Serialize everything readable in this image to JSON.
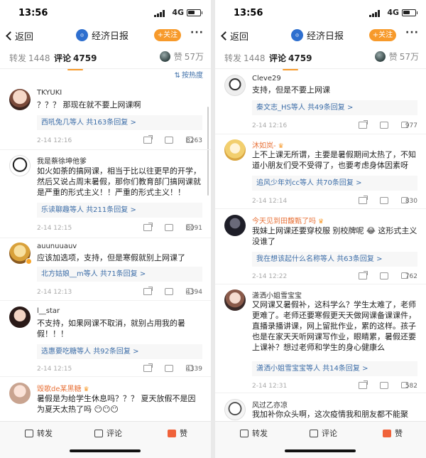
{
  "status": {
    "time": "13:56",
    "network": "4G"
  },
  "header": {
    "back_label": "返回",
    "account_name": "经济日报",
    "follow_label": "+关注",
    "more_label": "···"
  },
  "tabs": {
    "repost_label": "转发",
    "repost_count": "1448",
    "comment_label": "评论",
    "comment_count": "4759",
    "like_label": "赞",
    "like_count": "57万"
  },
  "sort_label": "按热度",
  "left": {
    "comments": [
      {
        "user": "TKYUKI",
        "text": "？？？ 那现在就不要上网课啊",
        "reply_user": "西吼兔几等人",
        "reply_count": "共163条回复 >",
        "date": "2-14 12:16",
        "likes": "8263"
      },
      {
        "user": "我是蔡徐坤他爹",
        "text": "如火如荼的搞网课，相当于比以往更早的开学，然后又说占周末暑假，那你们教育部门搞网课就是严重的形式主义！！严重的形式主义！！",
        "reply_user": "乐读聊趣等人",
        "reply_count": "共211条回复 >",
        "date": "2-14 12:15",
        "likes": "8091"
      },
      {
        "user": "auunuuauv",
        "text": "应该加选项，支持，但是寒假就别上网课了",
        "reply_user": "北方姑娘__m等人",
        "reply_count": "共71条回复 >",
        "date": "2-14 12:13",
        "likes": "4394"
      },
      {
        "user": "l__star",
        "text": "不支持，如果网课不取消，就别占用我的暑假！！！",
        "reply_user": "选惠要吃糖等人",
        "reply_count": "共92条回复 >",
        "date": "2-14 12:15",
        "likes": "4339"
      },
      {
        "user": "毁歌de某黑糖",
        "text": "暑假是为给学生休息吗？？？ 夏天放假不是因为夏天太热了吗 😶😶😶",
        "reply_user": "",
        "reply_count": "",
        "date": "",
        "likes": ""
      }
    ]
  },
  "right": {
    "comments": [
      {
        "user": "Cleve29",
        "text": "支持，但是不要上网课",
        "reply_user": "秦文志_HS等人",
        "reply_count": "共49条回复 >",
        "date": "2-14 12:16",
        "likes": "977"
      },
      {
        "user": "沐如岚-",
        "text": "上不上课无所谓，主要是暑假期间太热了，不知道小朋友们受不受得了，也要考虑身体因素呀",
        "reply_user": "追风少年刘cc等人",
        "reply_count": "共70条回复 >",
        "date": "2-14 12:14",
        "likes": "830"
      },
      {
        "user": "今天见到田馥甄了吗",
        "text": "我妹上网课还要穿校服 别校牌呢 😂 这形式主义没谁了",
        "reply_user": "我在想该起什么名称等人",
        "reply_count": "共63条回复 >",
        "date": "2-14 12:22",
        "likes": "762"
      },
      {
        "user": "潇洒小姐雪宝宝",
        "text": "又网课又暑假补，这科学么？学生太难了，老师更难了。老师还要寒假更天天做网课备课课件，直播录播讲课，网上留批作业，累的这样。孩子也是在家天天听网课写作业，眼睛累，暑假还要上课补？想过老师和学生的身心健康么",
        "reply_user": "潇洒小姐雪宝宝等人",
        "reply_count": "共14条回复 >",
        "date": "2-14 12:31",
        "likes": "582"
      },
      {
        "user": "风过乙亦凉",
        "text": "我加补你众头啊，这次疫情我和朋友都不能聚",
        "reply_user": "",
        "reply_count": "",
        "date": "",
        "likes": ""
      }
    ]
  },
  "bottom": {
    "repost": "转发",
    "comment": "评论",
    "like": "赞"
  }
}
